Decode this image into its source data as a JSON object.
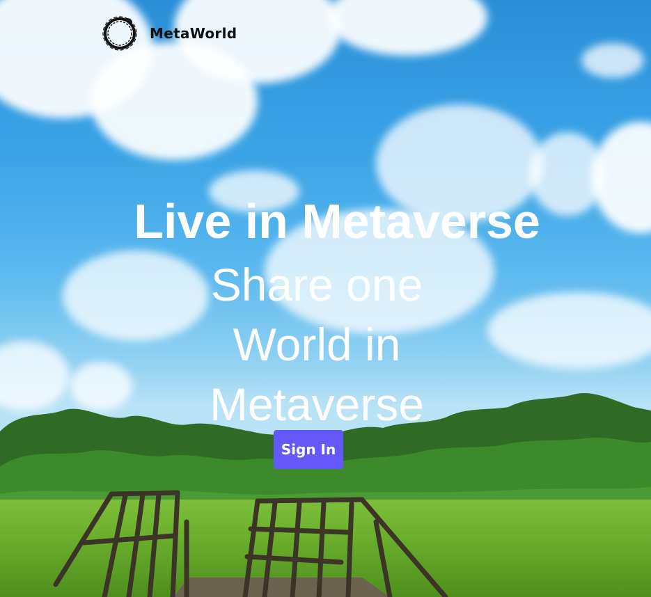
{
  "header": {
    "brand_name": "MetaWorld",
    "logo_icon": "ouroboros-ring-icon"
  },
  "hero": {
    "headline": "Live in Metaverse",
    "subheadline": "Share one World in Metaverse",
    "cta_label": "Sign In"
  },
  "colors": {
    "cta_background": "#6359f8",
    "cta_text": "#ffffff",
    "headline_text": "#ffffff",
    "brand_text": "#111111"
  }
}
